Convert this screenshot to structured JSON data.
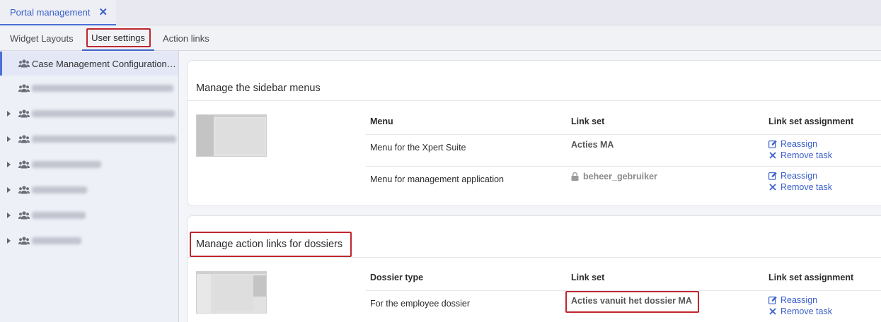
{
  "doc_tab": {
    "label": "Portal management",
    "close_icon": "close-icon"
  },
  "sub_tabs": [
    {
      "label": "Widget Layouts"
    },
    {
      "label": "User settings",
      "active": true
    },
    {
      "label": "Action links"
    }
  ],
  "sidebar": {
    "items": [
      {
        "label": "Case Management Configuration ...",
        "expandable": false,
        "active": true,
        "icon": "users-icon"
      },
      {
        "label": "",
        "expandable": false,
        "blurred": true,
        "icon": "users-icon"
      },
      {
        "label": "",
        "expandable": true,
        "blurred": true,
        "icon": "users-icon"
      },
      {
        "label": "",
        "expandable": true,
        "blurred": true,
        "icon": "users-icon"
      },
      {
        "label": "",
        "expandable": true,
        "blurred": true,
        "icon": "users-icon"
      },
      {
        "label": "",
        "expandable": true,
        "blurred": true,
        "icon": "users-icon"
      },
      {
        "label": "",
        "expandable": true,
        "blurred": true,
        "icon": "users-icon"
      },
      {
        "label": "",
        "expandable": true,
        "blurred": true,
        "icon": "users-icon"
      }
    ]
  },
  "sidebar_menus": {
    "title": "Manage the sidebar menus",
    "columns": [
      "Menu",
      "Link set",
      "Link set assignment"
    ],
    "rows": [
      {
        "menu": "Menu for the Xpert Suite",
        "link_set": "Acties MA",
        "locked": false,
        "reassign": "Reassign",
        "remove": "Remove task"
      },
      {
        "menu": "Menu for management application",
        "link_set": "beheer_gebruiker",
        "locked": true,
        "reassign": "Reassign",
        "remove": "Remove task"
      }
    ]
  },
  "dossier_links": {
    "title": "Manage action links for dossiers",
    "columns": [
      "Dossier type",
      "Link set",
      "Link set assignment"
    ],
    "rows": [
      {
        "dossier_type": "For the employee dossier",
        "link_set": "Acties vanuit het dossier MA",
        "reassign": "Reassign",
        "remove": "Remove task"
      }
    ]
  },
  "colors": {
    "accent": "#3a60c9",
    "highlight": "#c0262d",
    "sidebar_bg": "#eef0f7"
  }
}
